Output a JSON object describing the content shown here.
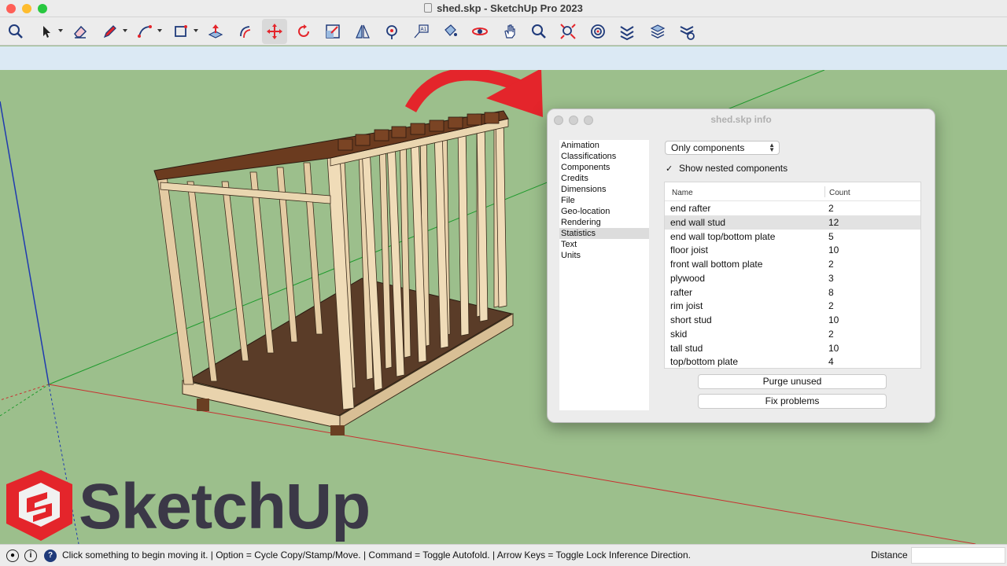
{
  "window": {
    "title": "shed.skp - SketchUp Pro 2023"
  },
  "toolbar": {
    "icons": [
      "search-tool",
      "select-tool",
      "eraser-tool",
      "pencil-tool",
      "arc-tool",
      "rectangle-tool",
      "push-pull-tool",
      "offset-tool",
      "move-tool",
      "rotate-tool",
      "scale-tool",
      "flip-tool",
      "follow-me-tool",
      "text-tool",
      "paint-bucket-tool",
      "orbit-tool",
      "pan-tool",
      "zoom-tool",
      "zoom-extents-tool",
      "warehouse-tool",
      "extension-tool",
      "layers-tool",
      "settings-tool"
    ],
    "active": "move-tool"
  },
  "dialog": {
    "title": "shed.skp info",
    "sidebar": [
      "Animation",
      "Classifications",
      "Components",
      "Credits",
      "Dimensions",
      "File",
      "Geo-location",
      "Rendering",
      "Statistics",
      "Text",
      "Units"
    ],
    "selected_section": "Statistics",
    "filter": "Only components",
    "show_nested_label": "Show nested components",
    "show_nested_checked": true,
    "table": {
      "headers": [
        "Name",
        "Count"
      ],
      "rows": [
        [
          "end rafter",
          "2"
        ],
        [
          "end wall stud",
          "12"
        ],
        [
          "end wall top/bottom plate",
          "5"
        ],
        [
          "floor joist",
          "10"
        ],
        [
          "front wall bottom plate",
          "2"
        ],
        [
          "plywood",
          "3"
        ],
        [
          "rafter",
          "8"
        ],
        [
          "rim joist",
          "2"
        ],
        [
          "short stud",
          "10"
        ],
        [
          "skid",
          "2"
        ],
        [
          "tall stud",
          "10"
        ],
        [
          "top/bottom plate",
          "4"
        ]
      ],
      "selected_row": 1
    },
    "purge_label": "Purge unused",
    "fix_label": "Fix problems"
  },
  "logo": {
    "text": "SketchUp"
  },
  "statusbar": {
    "message": "Click something to begin moving it. | Option = Cycle Copy/Stamp/Move. | Command = Toggle Autofold. | Arrow Keys = Toggle Lock Inference Direction.",
    "measurement_label": "Distance",
    "measurement_value": ""
  },
  "colors": {
    "ground": "#9cbf8c",
    "sky": "#dbe9f4",
    "arrow": "#e4252b",
    "logo_red": "#e4252b",
    "logo_text": "#3b3847"
  }
}
